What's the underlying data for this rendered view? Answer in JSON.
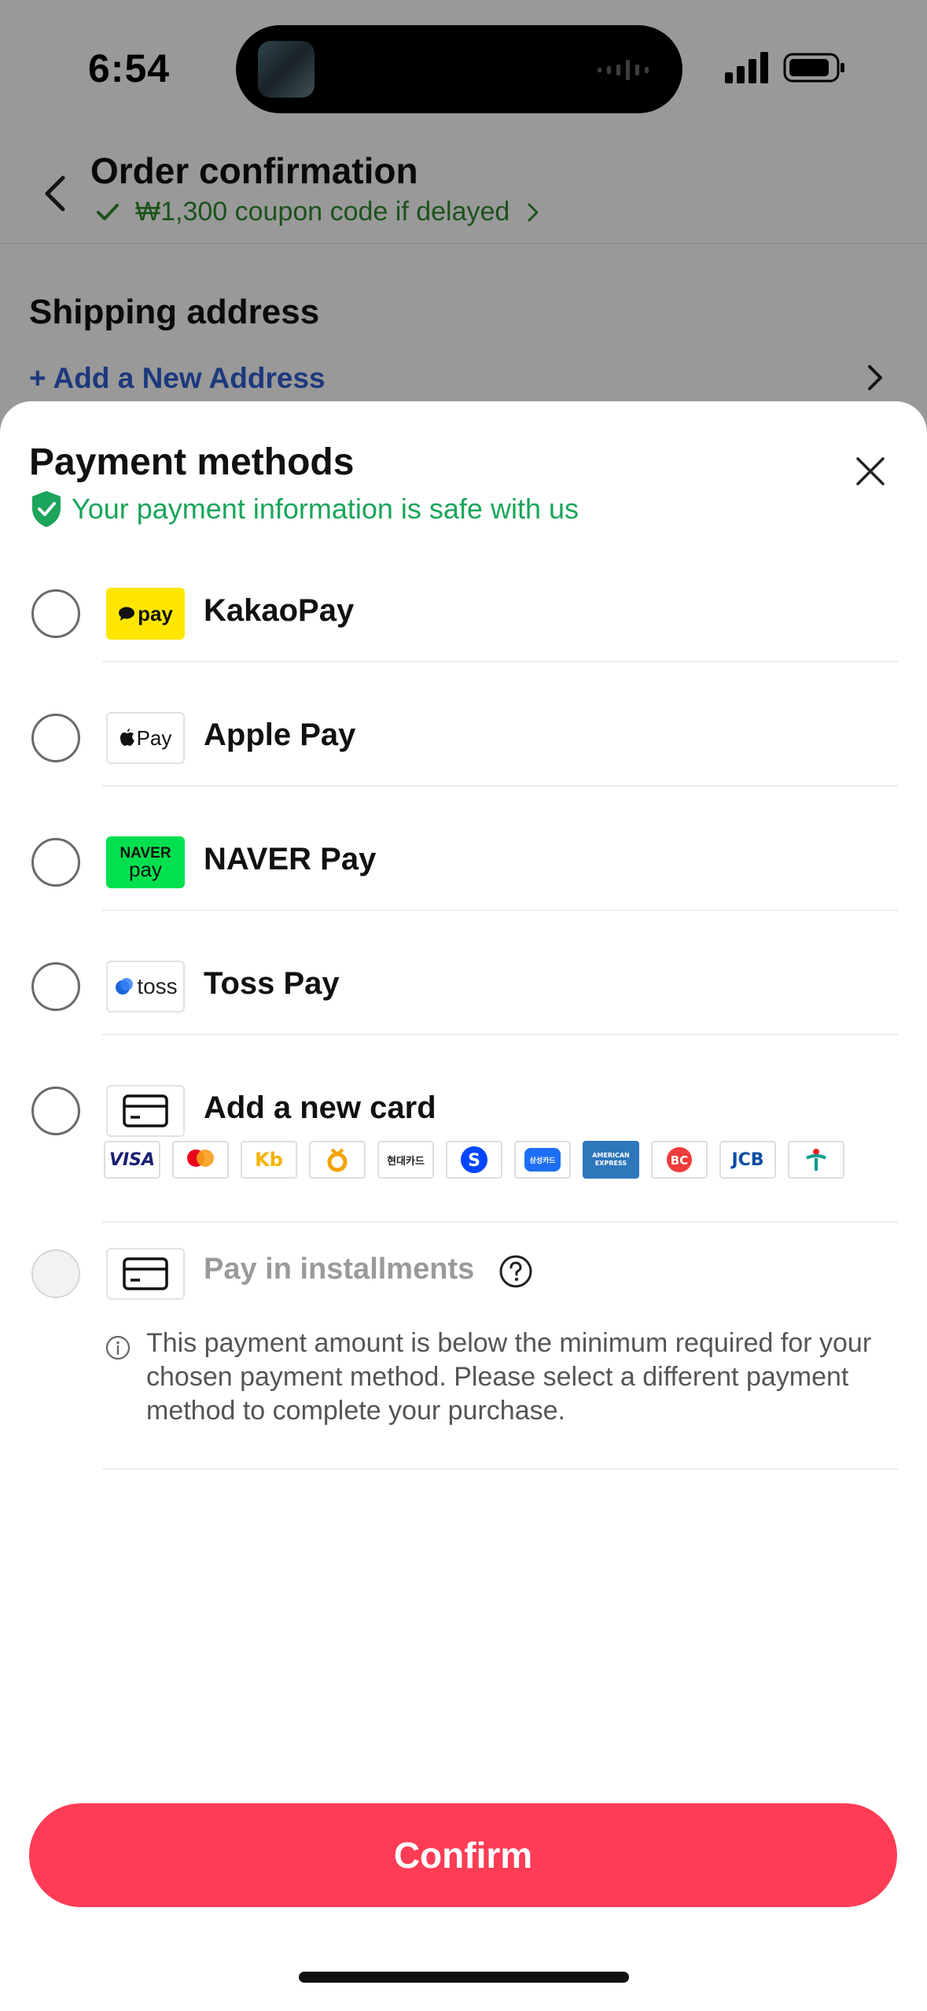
{
  "status_bar": {
    "time": "6:54"
  },
  "header": {
    "title": "Order confirmation",
    "coupon_text": "₩1,300 coupon code if delayed"
  },
  "shipping": {
    "title": "Shipping address",
    "add_address": "+ Add a New Address"
  },
  "sheet": {
    "title": "Payment methods",
    "safe_text": "Your payment information is safe with us",
    "methods": [
      {
        "label": "KakaoPay",
        "logo_text": "pay",
        "icon": "kakaopay-logo"
      },
      {
        "label": "Apple Pay",
        "logo_text": "Pay",
        "icon": "apple-pay-logo"
      },
      {
        "label": "NAVER Pay",
        "logo_text": "NAVER",
        "logo_text2": "pay",
        "icon": "naver-pay-logo"
      },
      {
        "label": "Toss Pay",
        "logo_text": "toss",
        "icon": "toss-pay-logo"
      },
      {
        "label": "Add a new card",
        "icon": "credit-card-icon"
      }
    ],
    "card_brands": [
      {
        "name": "visa-logo",
        "text": "VISA",
        "color": "#1a1f71"
      },
      {
        "name": "mastercard-logo",
        "text": "",
        "color": "#eb001b"
      },
      {
        "name": "kb-card-logo",
        "text": "Kb",
        "color": "#f5b300"
      },
      {
        "name": "nh-card-logo",
        "text": "",
        "color": "#f5a200"
      },
      {
        "name": "hyundai-card-logo",
        "text": "현대카드",
        "color": "#222222"
      },
      {
        "name": "shinhan-card-logo",
        "text": "S",
        "color": "#0046ff"
      },
      {
        "name": "samsung-card-logo",
        "text": "삼성카드",
        "color": "#1e6ef5"
      },
      {
        "name": "amex-logo",
        "text": "AMERICAN EXPRESS",
        "color": "#2e77bb"
      },
      {
        "name": "bc-card-logo",
        "text": "BC",
        "color": "#f03c3c"
      },
      {
        "name": "jcb-logo",
        "text": "JCB",
        "color": "#0b4ea2"
      },
      {
        "name": "hana-card-logo",
        "text": "",
        "color": "#009b8d"
      }
    ],
    "installments": {
      "label": "Pay in installments",
      "note": "This payment amount is below the minimum required for your chosen payment method. Please select a different payment method to complete your purchase."
    },
    "confirm_label": "Confirm"
  },
  "colors": {
    "accent": "#fe3c55",
    "safe_green": "#1aa55a",
    "coupon_green": "#2e8a2e",
    "link_blue": "#2f5fd0"
  }
}
